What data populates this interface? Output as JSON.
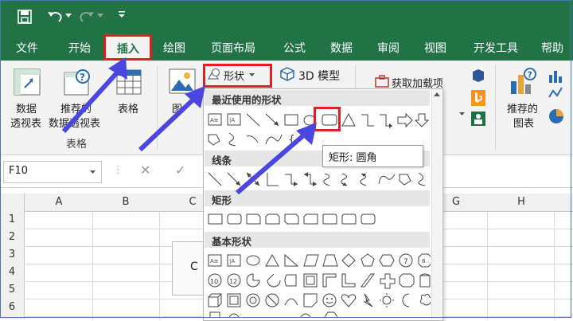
{
  "menu": {
    "items": [
      "文件",
      "开始",
      "插入",
      "绘图",
      "页面布局",
      "公式",
      "数据",
      "审阅",
      "视图",
      "开发工具",
      "帮助"
    ],
    "active": "插入"
  },
  "ribbon": {
    "pivot_label_1": "数据",
    "pivot_label_2": "透视表",
    "recommended_label_1": "推荐的",
    "recommended_label_2": "数据透视表",
    "table_label": "表格",
    "group_tables": "表格",
    "pictures_label": "图",
    "shapes_button": "形状",
    "model3d_button": "3D 模型",
    "addins_button": "获取加载项",
    "rec_charts_1": "推荐的",
    "rec_charts_2": "图表"
  },
  "formula_bar": {
    "name_box": "F10"
  },
  "grid": {
    "columns": [
      "A",
      "B",
      "C",
      "G",
      "H"
    ],
    "rows": [
      "1",
      "2",
      "3",
      "4",
      "5",
      "6"
    ],
    "cell_fragment": "C"
  },
  "shapes_menu": {
    "recent": "最近使用的形状",
    "lines": "线条",
    "rectangles": "矩形",
    "basic": "基本形状"
  },
  "tooltip": {
    "text": "矩形: 圆角"
  },
  "colors": {
    "excel_green": "#217346",
    "highlight_red": "#e02020",
    "arrow_blue": "#4b46e0"
  }
}
